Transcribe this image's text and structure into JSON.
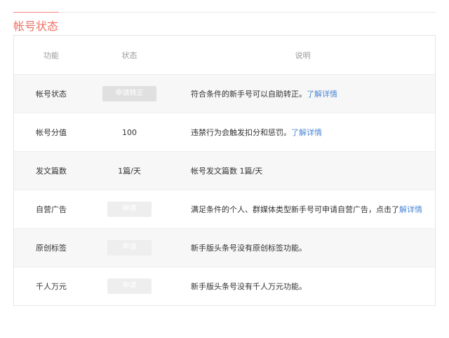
{
  "section_title": "帐号状态",
  "headers": [
    "功能",
    "状态",
    "说明"
  ],
  "rows": [
    {
      "feature": "帐号状态",
      "status_button": "申请转正",
      "desc": "符合条件的新手号可以自助转正。",
      "desc_link": "了解详情"
    },
    {
      "feature": "帐号分值",
      "status": "100",
      "desc": "违禁行为会触发扣分和惩罚。",
      "desc_link": "了解详情"
    },
    {
      "feature": "发文篇数",
      "status": "1篇/天",
      "desc": "帐号发文篇数 1篇/天"
    },
    {
      "feature": "自营广告",
      "status_button": "申请",
      "desc": "满足条件的个人、群媒体类型新手号可申请自营广告，点击了",
      "desc_link": "解详情"
    },
    {
      "feature": "原创标签",
      "status_button": "申请",
      "desc": "新手版头条号没有原创标签功能。"
    },
    {
      "feature": "千人万元",
      "status_button": "申请",
      "desc": "新手版头条号没有千人万元功能。"
    }
  ],
  "colors": {
    "accent": "#ef6f63",
    "link": "#4a86d4"
  }
}
